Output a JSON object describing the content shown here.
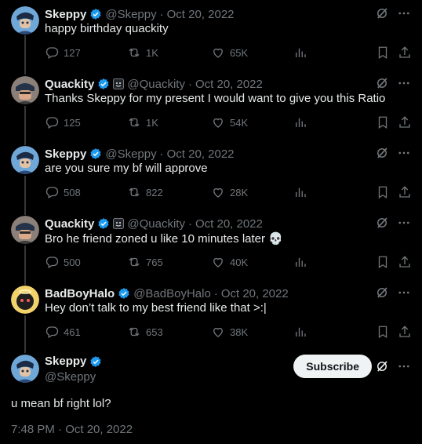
{
  "tweets": [
    {
      "name": "Skeppy",
      "handle": "@Skeppy",
      "date": "Oct 20, 2022",
      "sep": "·",
      "text": "happy birthday quackity",
      "replies": "127",
      "retweets": "1K",
      "likes": "65K"
    },
    {
      "name": "Quackity",
      "handle": "@Quackity",
      "date": "Oct 20, 2022",
      "sep": "·",
      "text": "Thanks Skeppy for my present I would want to give you this Ratio",
      "replies": "125",
      "retweets": "1K",
      "likes": "54K"
    },
    {
      "name": "Skeppy",
      "handle": "@Skeppy",
      "date": "Oct 20, 2022",
      "sep": "·",
      "text": "are you sure my bf will approve",
      "replies": "508",
      "retweets": "822",
      "likes": "28K"
    },
    {
      "name": "Quackity",
      "handle": "@Quackity",
      "date": "Oct 20, 2022",
      "sep": "·",
      "text": "Bro he friend zoned u like 10 minutes later 💀",
      "replies": "500",
      "retweets": "765",
      "likes": "40K"
    },
    {
      "name": "BadBoyHalo",
      "handle": "@BadBoyHalo",
      "date": "Oct 20, 2022",
      "sep": "·",
      "text": "Hey don’t talk to my best friend like that >:|",
      "replies": "461",
      "retweets": "653",
      "likes": "38K"
    }
  ],
  "main": {
    "name": "Skeppy",
    "handle": "@Skeppy",
    "subscribe_label": "Subscribe",
    "text": "u mean bf right lol?",
    "timestamp": "7:48 PM · Oct 20, 2022"
  },
  "colors": {
    "accent": "#1d9bf0",
    "muted": "#71767b",
    "text": "#e7e9ea",
    "bg": "#000000"
  }
}
